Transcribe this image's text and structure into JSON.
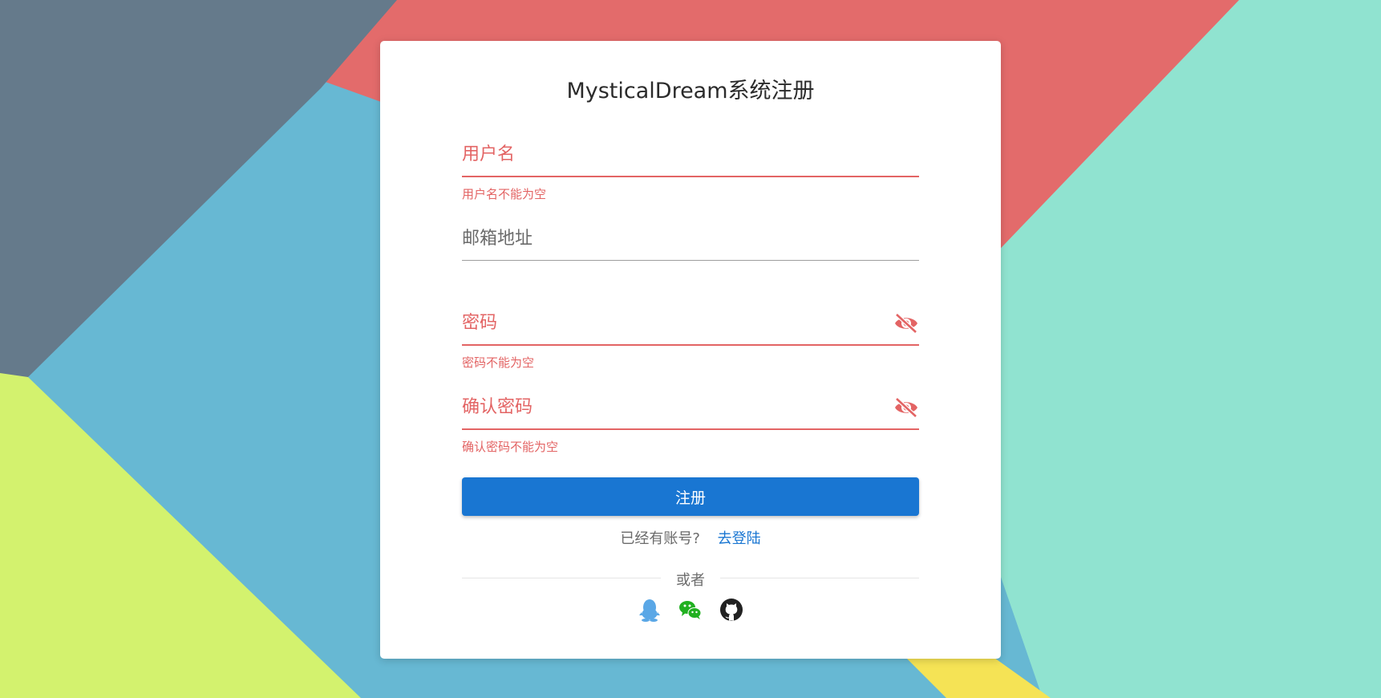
{
  "app": {
    "title": "MysticalDream系统注册"
  },
  "form": {
    "username": {
      "label": "用户名",
      "error": "用户名不能为空"
    },
    "email": {
      "label": "邮箱地址"
    },
    "password": {
      "label": "密码",
      "error": "密码不能为空"
    },
    "confirm_password": {
      "label": "确认密码",
      "error": "确认密码不能为空"
    },
    "submit_label": "注册"
  },
  "login_prompt": {
    "text": "已经有账号?",
    "link": "去登陆"
  },
  "divider_text": "或者",
  "social": {
    "items": [
      "qq-icon",
      "wechat-icon",
      "github-icon"
    ]
  },
  "colors": {
    "error": "#e36464",
    "primary": "#1976d2",
    "qq": "#5aa7e6",
    "wechat": "#21b020",
    "github": "#222222"
  }
}
